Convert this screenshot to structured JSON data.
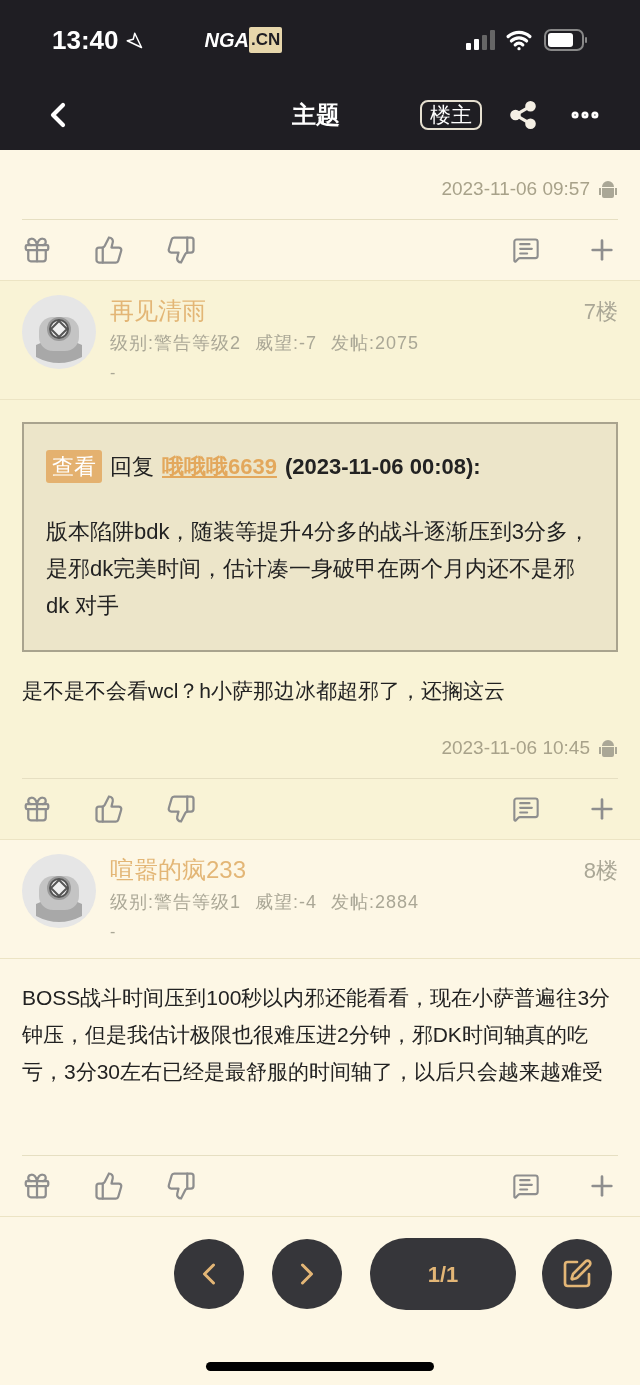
{
  "status_bar": {
    "time": "13:40",
    "logo_main": "NGA",
    "logo_suffix": ".CN"
  },
  "nav": {
    "title": "主题",
    "author_button": "楼主"
  },
  "posts": [
    {
      "timestamp": "2023-11-06 09:57"
    },
    {
      "author": "再见清雨",
      "floor": "7楼",
      "meta": [
        "级别:警告等级2",
        "威望:-7",
        "发帖:2075"
      ],
      "signature": "-",
      "quote": {
        "tag": "查看",
        "label": "回复",
        "user": "哦哦哦6639",
        "time": "(2023-11-06 00:08):",
        "text": "版本陷阱bdk，随装等提升4分多的战斗逐渐压到3分多，是邪dk完美时间，估计凑一身破甲在两个月内还不是邪dk 对手"
      },
      "body": "是不是不会看wcl？h小萨那边冰都超邪了，还搁这云",
      "timestamp": "2023-11-06 10:45"
    },
    {
      "author": "喧嚣的疯233",
      "floor": "8楼",
      "meta": [
        "级别:警告等级1",
        "威望:-4",
        "发帖:2884"
      ],
      "signature": "-",
      "body": "BOSS战斗时间压到100秒以内邪还能看看，现在小萨普遍往3分钟压，但是我估计极限也很难压进2分钟，邪DK时间轴真的吃亏，3分30左右已经是最舒服的时间轴了，以后只会越来越难受"
    }
  ],
  "pager": {
    "page": "1/1"
  }
}
